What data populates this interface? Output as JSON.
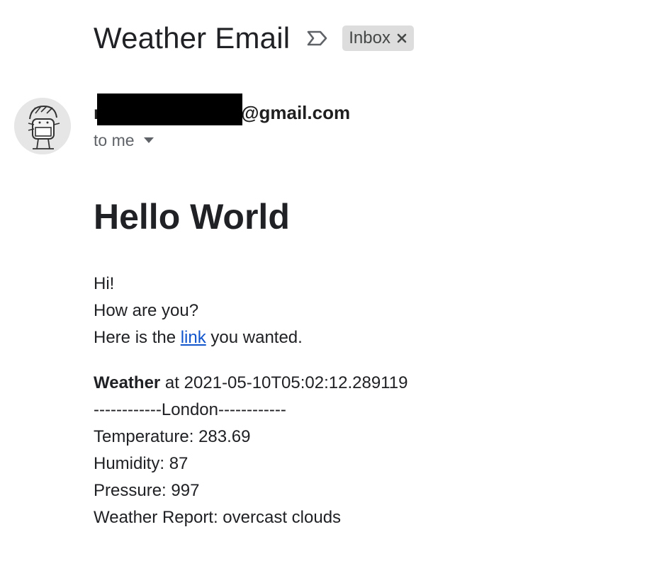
{
  "subject": {
    "title": "Weather Email",
    "label_chip": "Inbox",
    "icons": {
      "importance": "importance-marker-icon",
      "remove_label": "close-icon"
    }
  },
  "sender": {
    "email_suffix": "@gmail.com",
    "email_prefix_visible": "r",
    "recipients_text": "to me",
    "icons": {
      "avatar": "avatar",
      "recipients_toggle": "caret-down-icon"
    }
  },
  "body": {
    "heading": "Hello World",
    "greeting": "Hi!",
    "question": "How are you?",
    "link_sentence_prefix": "Here is the ",
    "link_text": "link",
    "link_sentence_suffix": " you wanted.",
    "weather_label": "Weather",
    "weather_timestamp_text": " at 2021-05-10T05:02:12.289119",
    "city_line": "------------London------------",
    "temperature": "Temperature: 283.69",
    "humidity": "Humidity: 87",
    "pressure": "Pressure: 997",
    "report": "Weather Report: overcast clouds"
  },
  "colors": {
    "link": "#1155cc",
    "chip_background": "#dddddd",
    "secondary_text": "#5f6368"
  }
}
